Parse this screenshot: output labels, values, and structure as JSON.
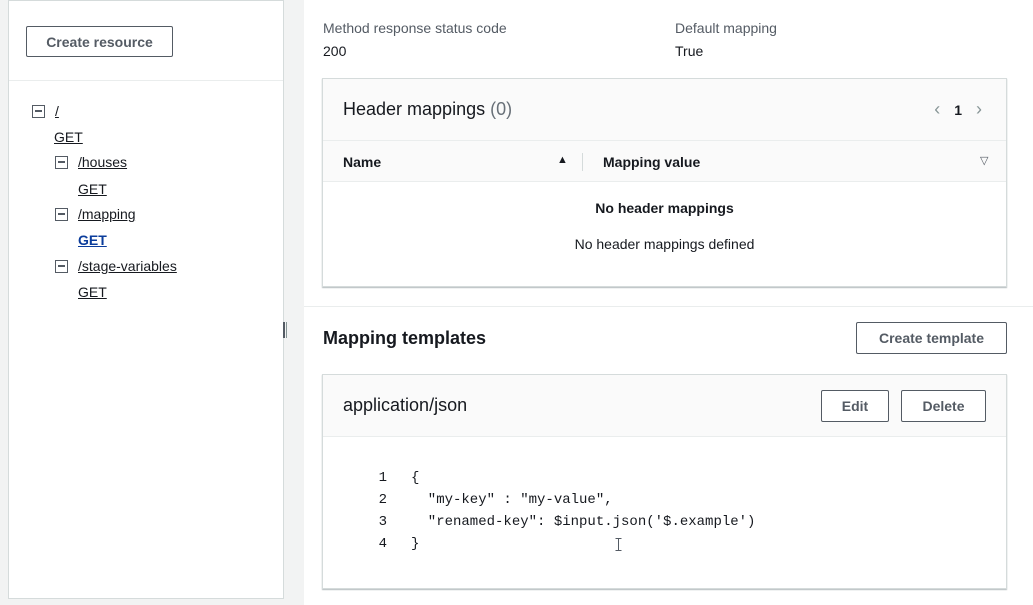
{
  "sidebar": {
    "create_resource_label": "Create resource",
    "tree": [
      {
        "label": "/",
        "level": 0,
        "toggle": true
      },
      {
        "label": "GET",
        "level": 0,
        "method": true
      },
      {
        "label": "/houses",
        "level": 1,
        "toggle": true
      },
      {
        "label": "GET",
        "level": 1,
        "method": true
      },
      {
        "label": "/mapping",
        "level": 1,
        "toggle": true
      },
      {
        "label": "GET",
        "level": 1,
        "method": true,
        "active": true
      },
      {
        "label": "/stage-variables",
        "level": 1,
        "toggle": true
      },
      {
        "label": "GET",
        "level": 1,
        "method": true
      }
    ]
  },
  "response": {
    "status_code_label": "Method response status code",
    "status_code_value": "200",
    "default_mapping_label": "Default mapping",
    "default_mapping_value": "True"
  },
  "header_mappings": {
    "title": "Header mappings",
    "count": "(0)",
    "page": "1",
    "columns": [
      "Name",
      "Mapping value"
    ],
    "empty_title": "No header mappings",
    "empty_desc": "No header mappings defined"
  },
  "mapping_templates": {
    "title": "Mapping templates",
    "create_label": "Create template",
    "template_name": "application/json",
    "edit_label": "Edit",
    "delete_label": "Delete",
    "code": [
      {
        "n": "1",
        "text": "{"
      },
      {
        "n": "2",
        "text": "  \"my-key\" : \"my-value\","
      },
      {
        "n": "3",
        "text": "  \"renamed-key\": $input.json('$.example')"
      },
      {
        "n": "4",
        "text": "}"
      }
    ]
  },
  "colors": {
    "accent_link": "#0b3c9b",
    "border": "#d5dbdb",
    "text": "#16191f"
  }
}
